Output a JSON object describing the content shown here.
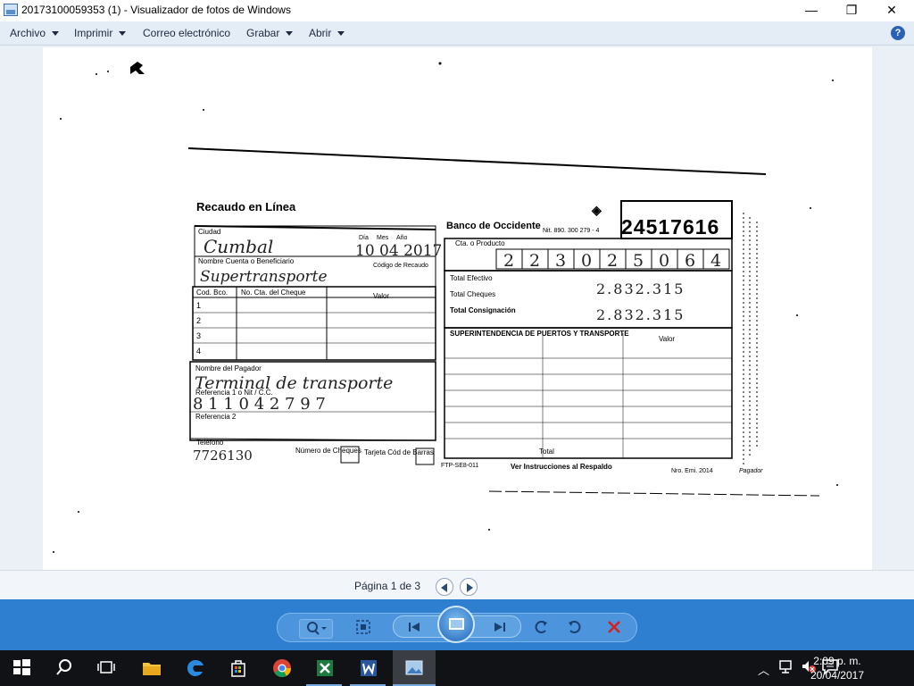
{
  "window": {
    "title": "20173100059353 (1) - Visualizador de fotos de Windows",
    "minimize": "—",
    "maximize": "❐",
    "close": "✕"
  },
  "menu": {
    "items": [
      {
        "label": "Archivo"
      },
      {
        "label": "Imprimir"
      },
      {
        "label": "Correo electrónico"
      },
      {
        "label": "Grabar"
      },
      {
        "label": "Abrir"
      }
    ],
    "help": "?"
  },
  "document": {
    "form_title": "Recaudo en Línea",
    "bank_name": "Banco de Occidente",
    "bank_nit": "Nit. 890. 300 279 - 4",
    "receipt_number": "24517616",
    "left_fields": {
      "ciudad_label": "Ciudad",
      "ciudad_value": "Cumbal",
      "dia": "Día",
      "mes": "Mes",
      "ano": "Año",
      "date_value": "10 04 2017",
      "beneficiario_label": "Nombre Cuenta o Beneficiario",
      "beneficiario_value": "Supertransporte",
      "codigo_recaudo": "Código de Recaudo",
      "cod_bco": "Cod. Bco.",
      "no_cta": "No. Cta. del Cheque",
      "valor": "Valor",
      "rows": [
        "1",
        "2",
        "3",
        "4"
      ],
      "pagador_label": "Nombre del Pagador",
      "pagador_value": "Terminal de transporte",
      "referencia1_label": "Referencia 1 o Nit / C.C.",
      "referencia1_value": "8 1 1 0 4 2 7 9 7",
      "referencia2_label": "Referencia 2",
      "telefono_label": "Teléfono",
      "telefono_value": "7726130",
      "numero_cheques": "Número de Cheques",
      "tarjeta": "Tarjeta Cód de Barras"
    },
    "right_fields": {
      "cta_producto": "Cta. o Producto",
      "account_digits": [
        "2",
        "2",
        "3",
        "0",
        "2",
        "5",
        "0",
        "6",
        "4"
      ],
      "total_efectivo": "Total Efectivo",
      "total_efectivo_value": "2.832.315",
      "total_cheques": "Total Cheques",
      "total_consignacion": "Total Consignación",
      "total_consignacion_value": "2.832.315",
      "stamp_header": "SUPERINTENDENCIA DE PUERTOS Y TRANSPORTE",
      "stamp_valor": "Valor",
      "total_label": "Total",
      "footer_code": "FTP-SE8-011",
      "footer_note": "Ver Instrucciones al Respaldo",
      "footer_ref": "Nro. Emi. 2014",
      "footer_pagador": "Pagador"
    }
  },
  "status": {
    "page_label": "Página 1 de 3"
  },
  "taskbar": {
    "time": "2:09 p. m.",
    "date": "20/04/2017"
  }
}
